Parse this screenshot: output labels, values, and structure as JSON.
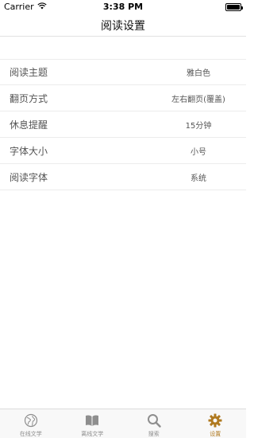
{
  "status_bar": {
    "carrier": "Carrier",
    "time": "3:38 PM",
    "wifi_icon": "wifi-icon",
    "battery_icon": "battery-icon",
    "battery_level": 1.0
  },
  "nav": {
    "title": "阅读设置"
  },
  "settings": [
    {
      "label": "阅读主题",
      "value": "雅白色"
    },
    {
      "label": "翻页方式",
      "value": "左右翻页(覆盖)"
    },
    {
      "label": "休息提醒",
      "value": "15分钟"
    },
    {
      "label": "字体大小",
      "value": "小号"
    },
    {
      "label": "阅读字体",
      "value": "系统"
    }
  ],
  "tabbar": {
    "accent_color": "#b07a20",
    "inactive_color": "#8e8e8e",
    "tabs": [
      {
        "label": "在线文学",
        "icon": "globe-icon",
        "active": false
      },
      {
        "label": "离线文学",
        "icon": "book-icon",
        "active": false
      },
      {
        "label": "搜索",
        "icon": "search-icon",
        "active": false
      },
      {
        "label": "设置",
        "icon": "gear-icon",
        "active": true
      }
    ]
  }
}
